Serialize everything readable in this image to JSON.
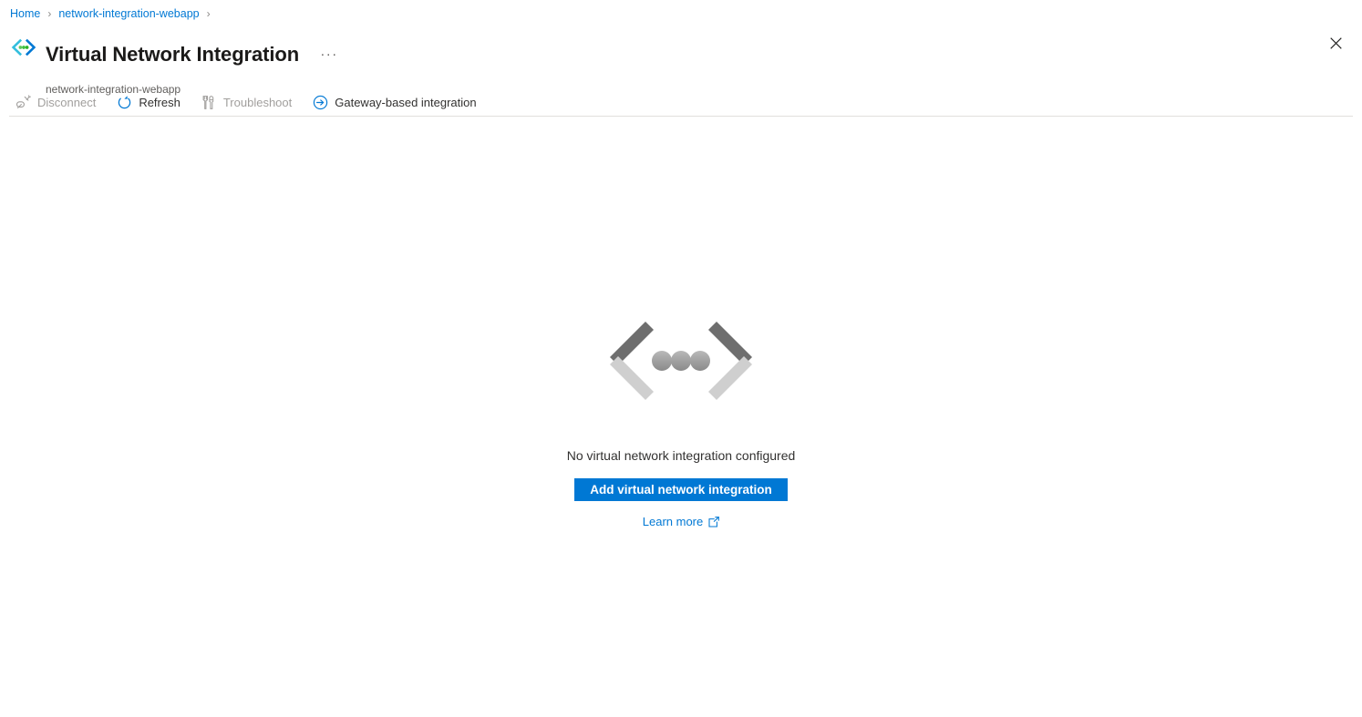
{
  "breadcrumb": {
    "items": [
      {
        "label": "Home"
      },
      {
        "label": "network-integration-webapp"
      }
    ],
    "separator": "›"
  },
  "header": {
    "icon": "vnet-integration-icon",
    "title": "Virtual Network Integration",
    "subtitle": "network-integration-webapp",
    "more_label": "···",
    "close_label": "Close"
  },
  "command_bar": {
    "commands": [
      {
        "label": "Disconnect",
        "icon": "disconnect-icon",
        "enabled": false
      },
      {
        "label": "Refresh",
        "icon": "refresh-icon",
        "enabled": true
      },
      {
        "label": "Troubleshoot",
        "icon": "troubleshoot-icon",
        "enabled": false
      },
      {
        "label": "Gateway-based integration",
        "icon": "arrow-circle-right-icon",
        "enabled": true
      }
    ]
  },
  "empty_state": {
    "illustration": "angle-brackets-dots-illustration",
    "message": "No virtual network integration configured",
    "primary_button": "Add virtual network integration",
    "learn_more": "Learn more",
    "learn_more_icon": "external-link-icon"
  },
  "colors": {
    "accent": "#0078d4",
    "link": "#0078d4",
    "text_primary": "#323130",
    "text_secondary": "#605e5c",
    "text_disabled": "#a19f9d",
    "divider": "#e1dfdd",
    "illustration_dark": "#6e6e6e",
    "illustration_light": "#cfcfcf"
  }
}
